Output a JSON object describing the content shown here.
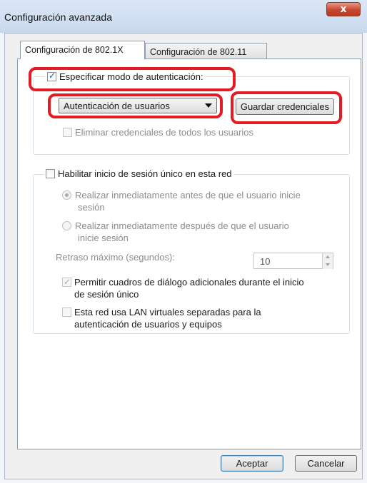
{
  "window": {
    "title": "Configuración avanzada",
    "close_glyph": "x"
  },
  "tabs": [
    {
      "label": "Configuración de 802.1X",
      "active": true
    },
    {
      "label": "Configuración de 802.11",
      "active": false
    }
  ],
  "auth_group": {
    "specify_mode_label": "Especificar modo de autenticación:",
    "specify_mode_checked": true,
    "auth_mode_value": "Autenticación de usuarios",
    "save_credentials_label": "Guardar credenciales",
    "delete_credentials_label": "Eliminar credenciales de todos los usuarios",
    "delete_credentials_checked": false
  },
  "sso_group": {
    "enable_sso_label": "Habilitar inicio de sesión único en esta red",
    "enable_sso_checked": false,
    "radio_before_line1": "Realizar inmediatamente antes de que el usuario inicie",
    "radio_before_line2": "sesión",
    "radio_before_selected": true,
    "radio_after_line1": "Realizar inmediatamente después de que el usuario",
    "radio_after_line2": "inicie sesión",
    "max_delay_label": "Retraso máximo (segundos):",
    "max_delay_value": "10",
    "allow_dialogs_line1": "Permitir cuadros de diálogo adicionales durante el inicio",
    "allow_dialogs_line2": "de sesión único",
    "allow_dialogs_checked": true,
    "separate_vlan_line1": "Esta red usa LAN virtuales separadas para la",
    "separate_vlan_line2": "autenticación de usuarios y equipos",
    "separate_vlan_checked": false
  },
  "buttons": {
    "ok": "Aceptar",
    "cancel": "Cancelar"
  },
  "colors": {
    "highlight_annotation": "#e31b23",
    "default_button_border": "#3c7fb1"
  }
}
